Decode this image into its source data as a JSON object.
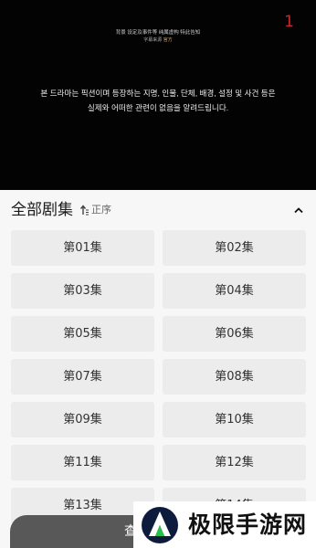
{
  "video": {
    "top_line1": "背景 设定及事件等 纯属虚构 特此告知",
    "top_line2_prefix": "字幕来源",
    "top_line2_highlight": "官方",
    "episode_number": "1",
    "subtitle_line1": "본 드라마는 픽션이며 등장하는 지명, 인물, 단체, 배경, 설정 및 사건 등은",
    "subtitle_line2": "실제와 어떠한 관련이 없음을 알려드립니다."
  },
  "panel": {
    "title": "全部剧集",
    "sort_label": "正序",
    "episodes": [
      "第01集",
      "第02集",
      "第03集",
      "第04集",
      "第05集",
      "第06集",
      "第07集",
      "第08集",
      "第09集",
      "第10集",
      "第11集",
      "第12集",
      "第13集",
      "第14集"
    ]
  },
  "bottom": {
    "button_label": "查"
  },
  "watermark": {
    "text": "极限手游网"
  },
  "colors": {
    "accent_red": "#c8282e",
    "panel_bg": "#f7f7f7",
    "episode_bg": "#ececec"
  }
}
